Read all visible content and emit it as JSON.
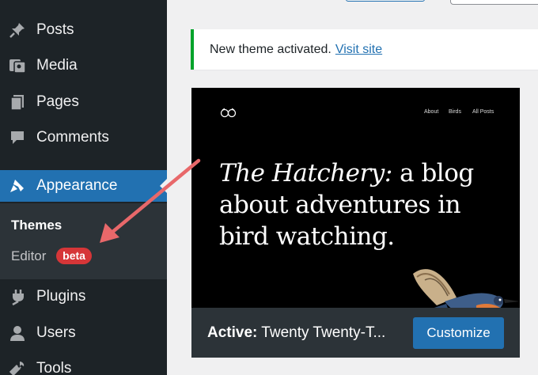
{
  "sidebar": {
    "items": [
      {
        "label": "Posts",
        "icon": "pushpin-icon"
      },
      {
        "label": "Media",
        "icon": "media-icon"
      },
      {
        "label": "Pages",
        "icon": "pages-icon"
      },
      {
        "label": "Comments",
        "icon": "comment-icon"
      },
      {
        "label": "Appearance",
        "icon": "paintbrush-icon",
        "active": true
      },
      {
        "label": "Plugins",
        "icon": "plug-icon"
      },
      {
        "label": "Users",
        "icon": "user-icon"
      },
      {
        "label": "Tools",
        "icon": "wrench-icon"
      }
    ],
    "submenu": [
      {
        "label": "Themes",
        "current": true
      },
      {
        "label": "Editor",
        "badge": "beta"
      }
    ]
  },
  "notice": {
    "message": "New theme activated.",
    "link": "Visit site"
  },
  "theme": {
    "nav": [
      "About",
      "Birds",
      "All Posts"
    ],
    "headline_italic": "The Hatchery:",
    "headline_rest": " a blog about adventures in bird watching.",
    "active_prefix": "Active:",
    "active_name": "Twenty Twenty-T...",
    "customize_label": "Customize"
  },
  "colors": {
    "sidebar_bg": "#1d2327",
    "submenu_bg": "#2c3338",
    "accent": "#2271b1",
    "badge": "#d63638",
    "notice_border": "#00a32a",
    "annotation_arrow": "#e8686a"
  }
}
